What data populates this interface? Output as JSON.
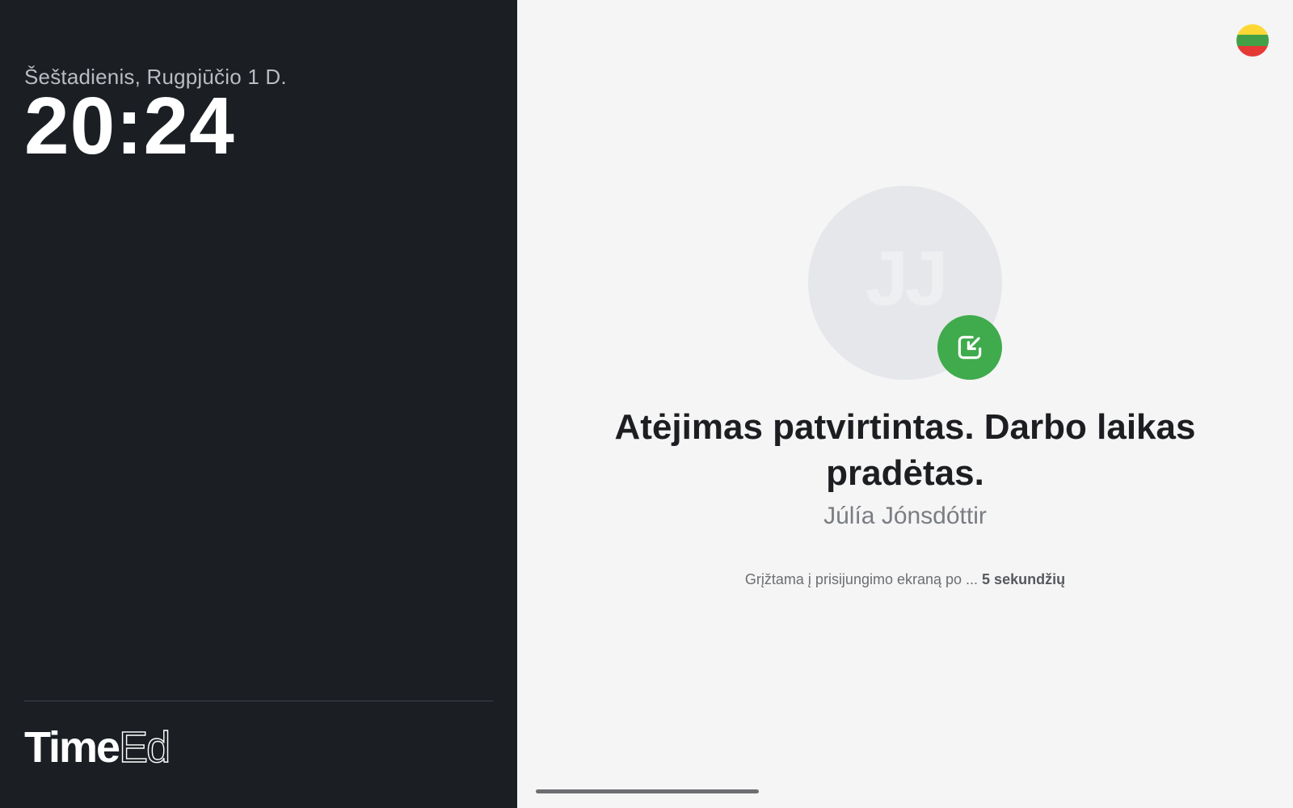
{
  "left": {
    "date": "Šeštadienis, Rugpjūčio 1 D.",
    "time": "20:24",
    "logo": {
      "bold": "Time",
      "light": "Ed"
    }
  },
  "right": {
    "flag": {
      "colors": [
        "#fdd835",
        "#43a047",
        "#e53935"
      ],
      "icon": "lithuania-flag-icon"
    },
    "avatar": {
      "initials": "JJ"
    },
    "badge": {
      "icon": "clock-in-arrow-icon",
      "color": "#3fab4c"
    },
    "headline": "Atėjimas patvirtintas. Darbo laikas pradėtas.",
    "name": "Júlía Jónsdóttir",
    "countdown": {
      "prefix": "Grįžtama į prisijungimo ekraną po ... ",
      "value": "5 sekundžių"
    }
  }
}
